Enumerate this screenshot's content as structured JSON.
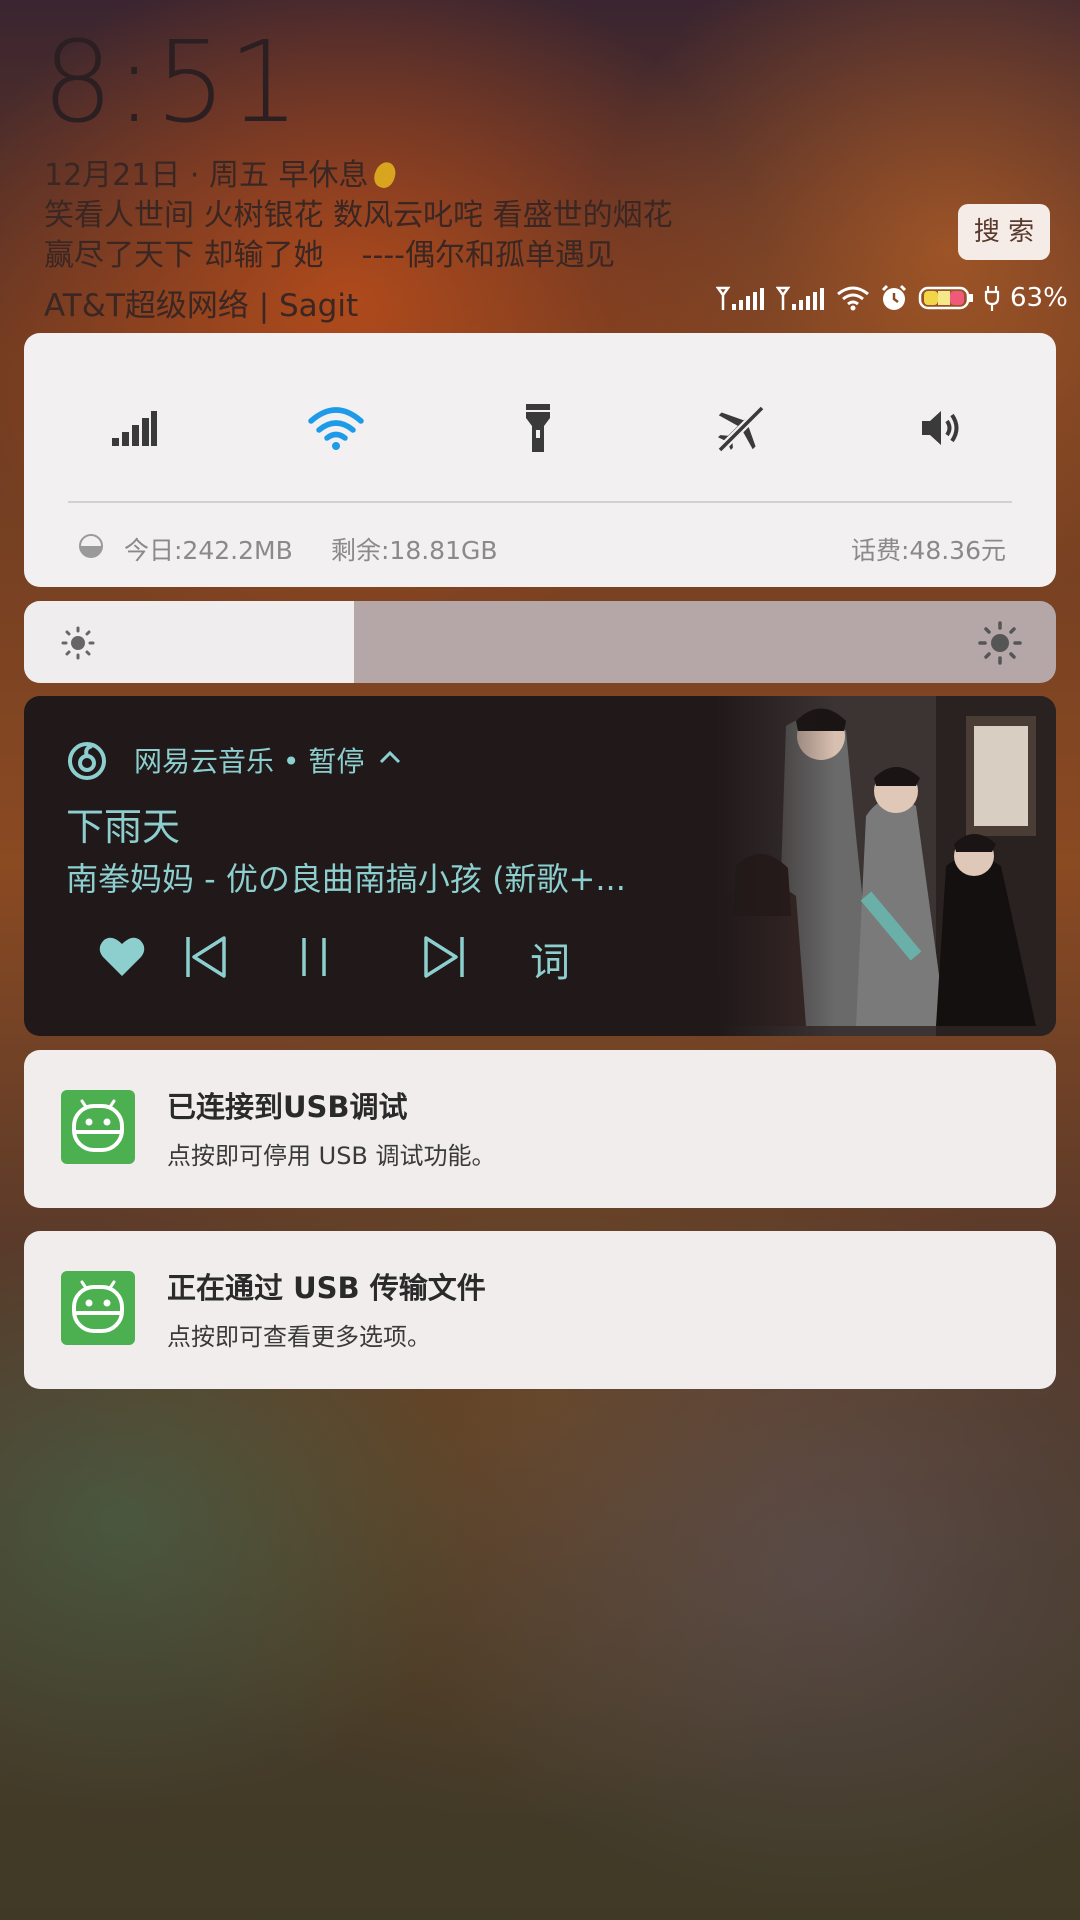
{
  "lockscreen": {
    "time": "8:51",
    "date": "12月21日 · 周五 早休息",
    "quote_line1": "笑看人世间 火树银花 数风云叱咤 看盛世的烟花",
    "quote_line2": "赢尽了天下 却输了她    ----偶尔和孤单遇见",
    "search_label": "搜 索",
    "carrier": "AT&T超级网络 | Sagit"
  },
  "status": {
    "battery_percent": "63%",
    "icons": [
      "signal-icon",
      "signal-icon",
      "wifi-icon",
      "alarm-icon",
      "battery-icon",
      "charging-icon"
    ]
  },
  "quick_settings": {
    "toggles": [
      {
        "name": "mobile-data",
        "icon": "signal-bars-icon",
        "active": false
      },
      {
        "name": "wifi",
        "icon": "wifi-icon",
        "active": true
      },
      {
        "name": "flashlight",
        "icon": "flashlight-icon",
        "active": false
      },
      {
        "name": "airplane-mode",
        "icon": "airplane-off-icon",
        "active": false
      },
      {
        "name": "sound",
        "icon": "speaker-icon",
        "active": false
      }
    ],
    "data_today": "今日:242.2MB",
    "data_remaining": "剩余:18.81GB",
    "balance": "话费:48.36元",
    "accent_color": "#1e9be8"
  },
  "brightness": {
    "level": 0.32
  },
  "music": {
    "app_status": "网易云音乐 • 暂停",
    "song_title": "下雨天",
    "artist_album": "南拳妈妈 - 优の良曲南搞小孩 (新歌+...",
    "lyrics_button": "词",
    "accent_color": "#8ccfce"
  },
  "notifications": [
    {
      "title": "已连接到USB调试",
      "subtitle": "点按即可停用 USB 调试功能。",
      "icon": "android-debug-icon"
    },
    {
      "title": "正在通过 USB 传输文件",
      "subtitle": "点按即可查看更多选项。",
      "icon": "android-usb-icon"
    }
  ]
}
